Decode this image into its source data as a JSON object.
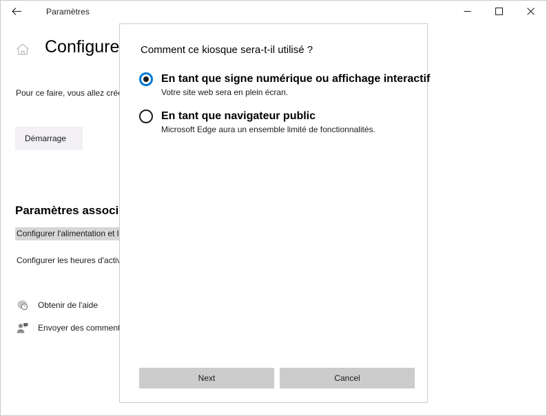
{
  "window": {
    "title": "Paramètres",
    "back_icon": "back-arrow-icon",
    "minimize_icon": "minimize-icon",
    "maximize_icon": "maximize-icon",
    "close_icon": "close-icon"
  },
  "page": {
    "home_icon": "home-icon",
    "title": "Configurer un",
    "description": "Pour ce faire, vous allez créer uniquement l'application qu'il peut utiliser",
    "startup_button": "Démarrage",
    "related_settings_title": "Paramètres associés",
    "related_links": [
      "Configurer l'alimentation et le traîneau",
      "Configurer les heures d'activité"
    ],
    "footer_links": [
      {
        "icon": "help-bubble-icon",
        "label": "Obtenir de l'aide"
      },
      {
        "icon": "feedback-person-icon",
        "label": "Envoyer des commentaires"
      }
    ]
  },
  "dialog": {
    "question": "Comment ce kiosque sera-t-il utilisé ?",
    "options": [
      {
        "label": "En tant que signe numérique ou affichage interactif",
        "description": "Votre site web sera en plein écran.",
        "selected": true
      },
      {
        "label": "En tant que navigateur public",
        "description": "Microsoft Edge aura un ensemble limité de fonctionnalités.",
        "selected": false
      }
    ],
    "next_button": "Next",
    "cancel_button": "Cancel"
  },
  "colors": {
    "accent": "#0078d4",
    "button_face": "#cccccc",
    "highlight": "#d6d6d6",
    "startup_face": "#f2f0f4"
  }
}
